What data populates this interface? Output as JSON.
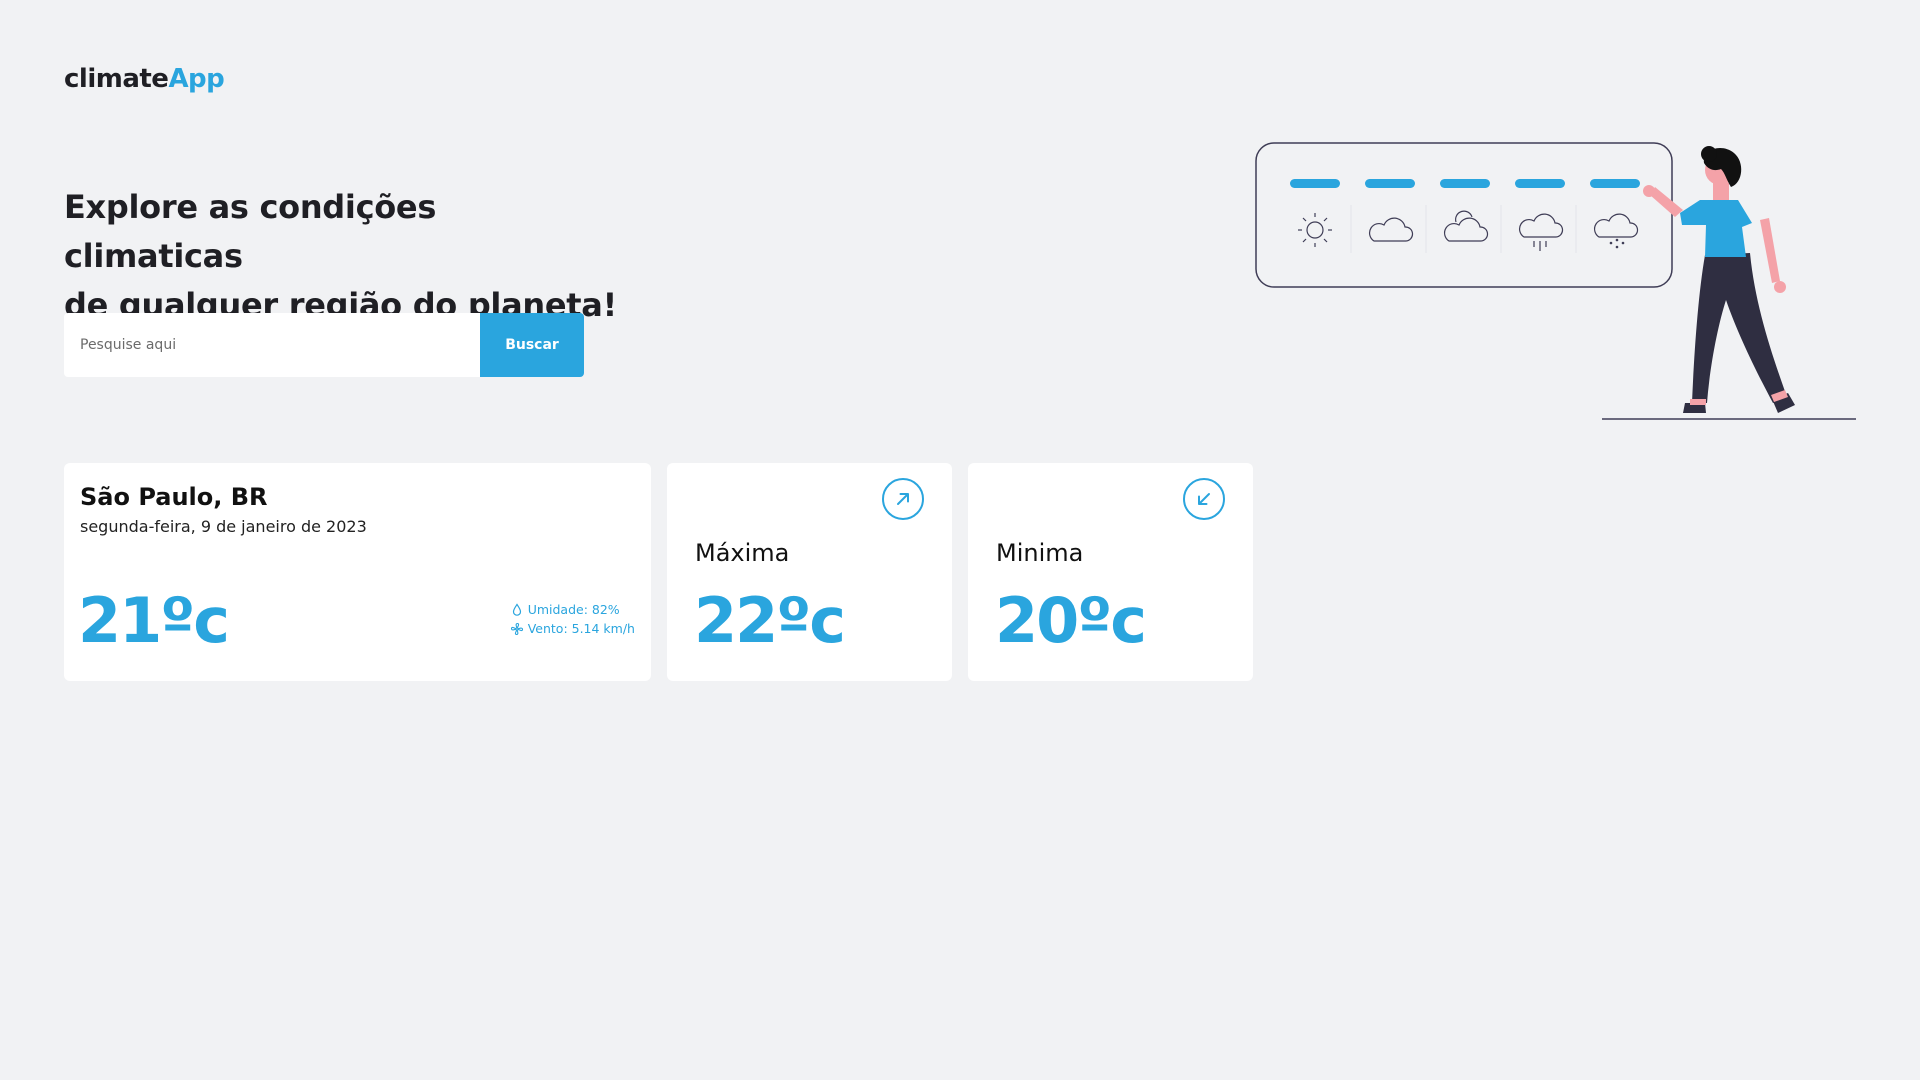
{
  "brand": {
    "part1": "climate",
    "part2": "App"
  },
  "hero": {
    "line1": "Explore as condições climaticas",
    "line2": "de qualquer região do planeta!"
  },
  "search": {
    "placeholder": "Pesquise aqui",
    "button_label": "Buscar"
  },
  "current": {
    "city": "São Paulo, BR",
    "date": "segunda-feira, 9 de janeiro de 2023",
    "temperature": "21ºc",
    "humidity": "Umidade: 82%",
    "wind": "Vento: 5.14 km/h"
  },
  "max_card": {
    "label": "Máxima",
    "temperature": "22ºc",
    "icon": "arrow-up-right-icon"
  },
  "min_card": {
    "label": "Minima",
    "temperature": "20ºc",
    "icon": "arrow-down-left-icon"
  },
  "colors": {
    "accent": "#2aa5de",
    "background": "#f1f2f4",
    "text": "#1f1f24"
  }
}
